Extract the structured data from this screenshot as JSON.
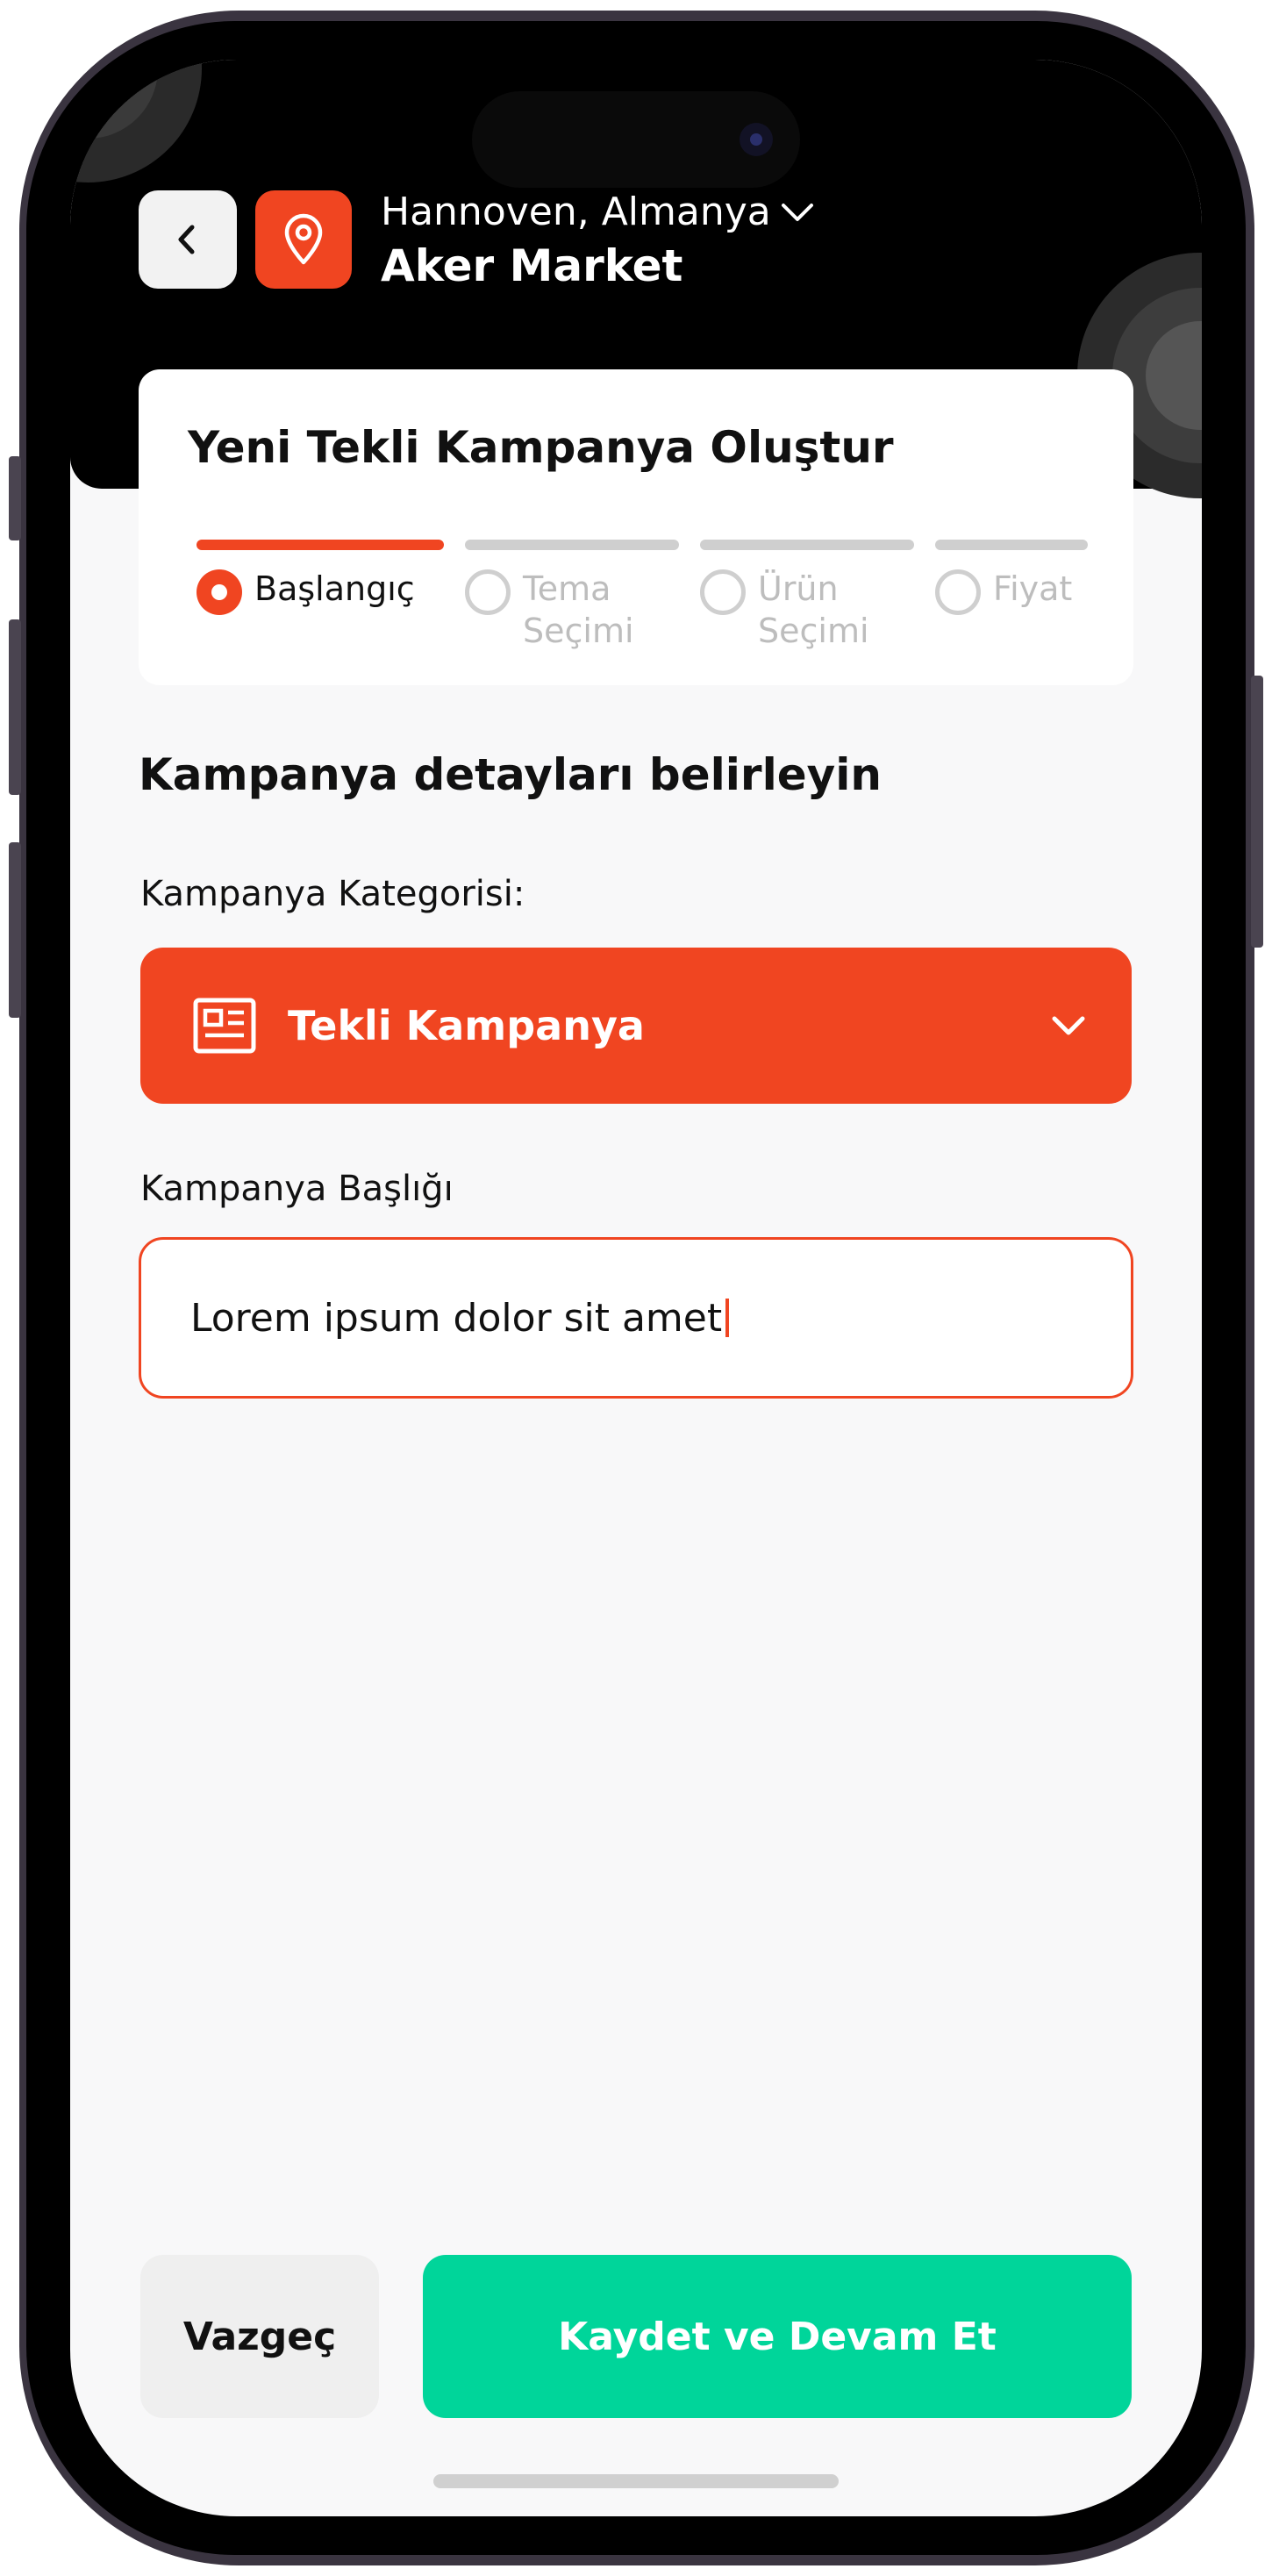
{
  "header": {
    "location_city": "Hannoven, Almanya",
    "store_name": "Aker Market"
  },
  "wizard": {
    "title": "Yeni Tekli Kampanya Oluştur",
    "steps": [
      {
        "label": "Başlangıç",
        "active": true
      },
      {
        "label": "Tema\nSeçimi",
        "active": false
      },
      {
        "label": "Ürün\nSeçimi",
        "active": false
      },
      {
        "label": "Fiyat",
        "active": false
      }
    ]
  },
  "form": {
    "section_title": "Kampanya detayları belirleyin",
    "category_label": "Kampanya Kategorisi:",
    "category_value": "Tekli Kampanya",
    "title_label": "Kampanya Başlığı",
    "title_value": "Lorem ipsum dolor sit amet"
  },
  "actions": {
    "cancel_label": "Vazgeç",
    "save_label": "Kaydet ve Devam Et"
  },
  "colors": {
    "accent": "#f04521",
    "primary_button": "#00d59a",
    "inactive": "#cfcfcf"
  },
  "icons": [
    "back-chevron-icon",
    "location-pin-icon",
    "chevron-down-icon",
    "newspaper-icon"
  ]
}
